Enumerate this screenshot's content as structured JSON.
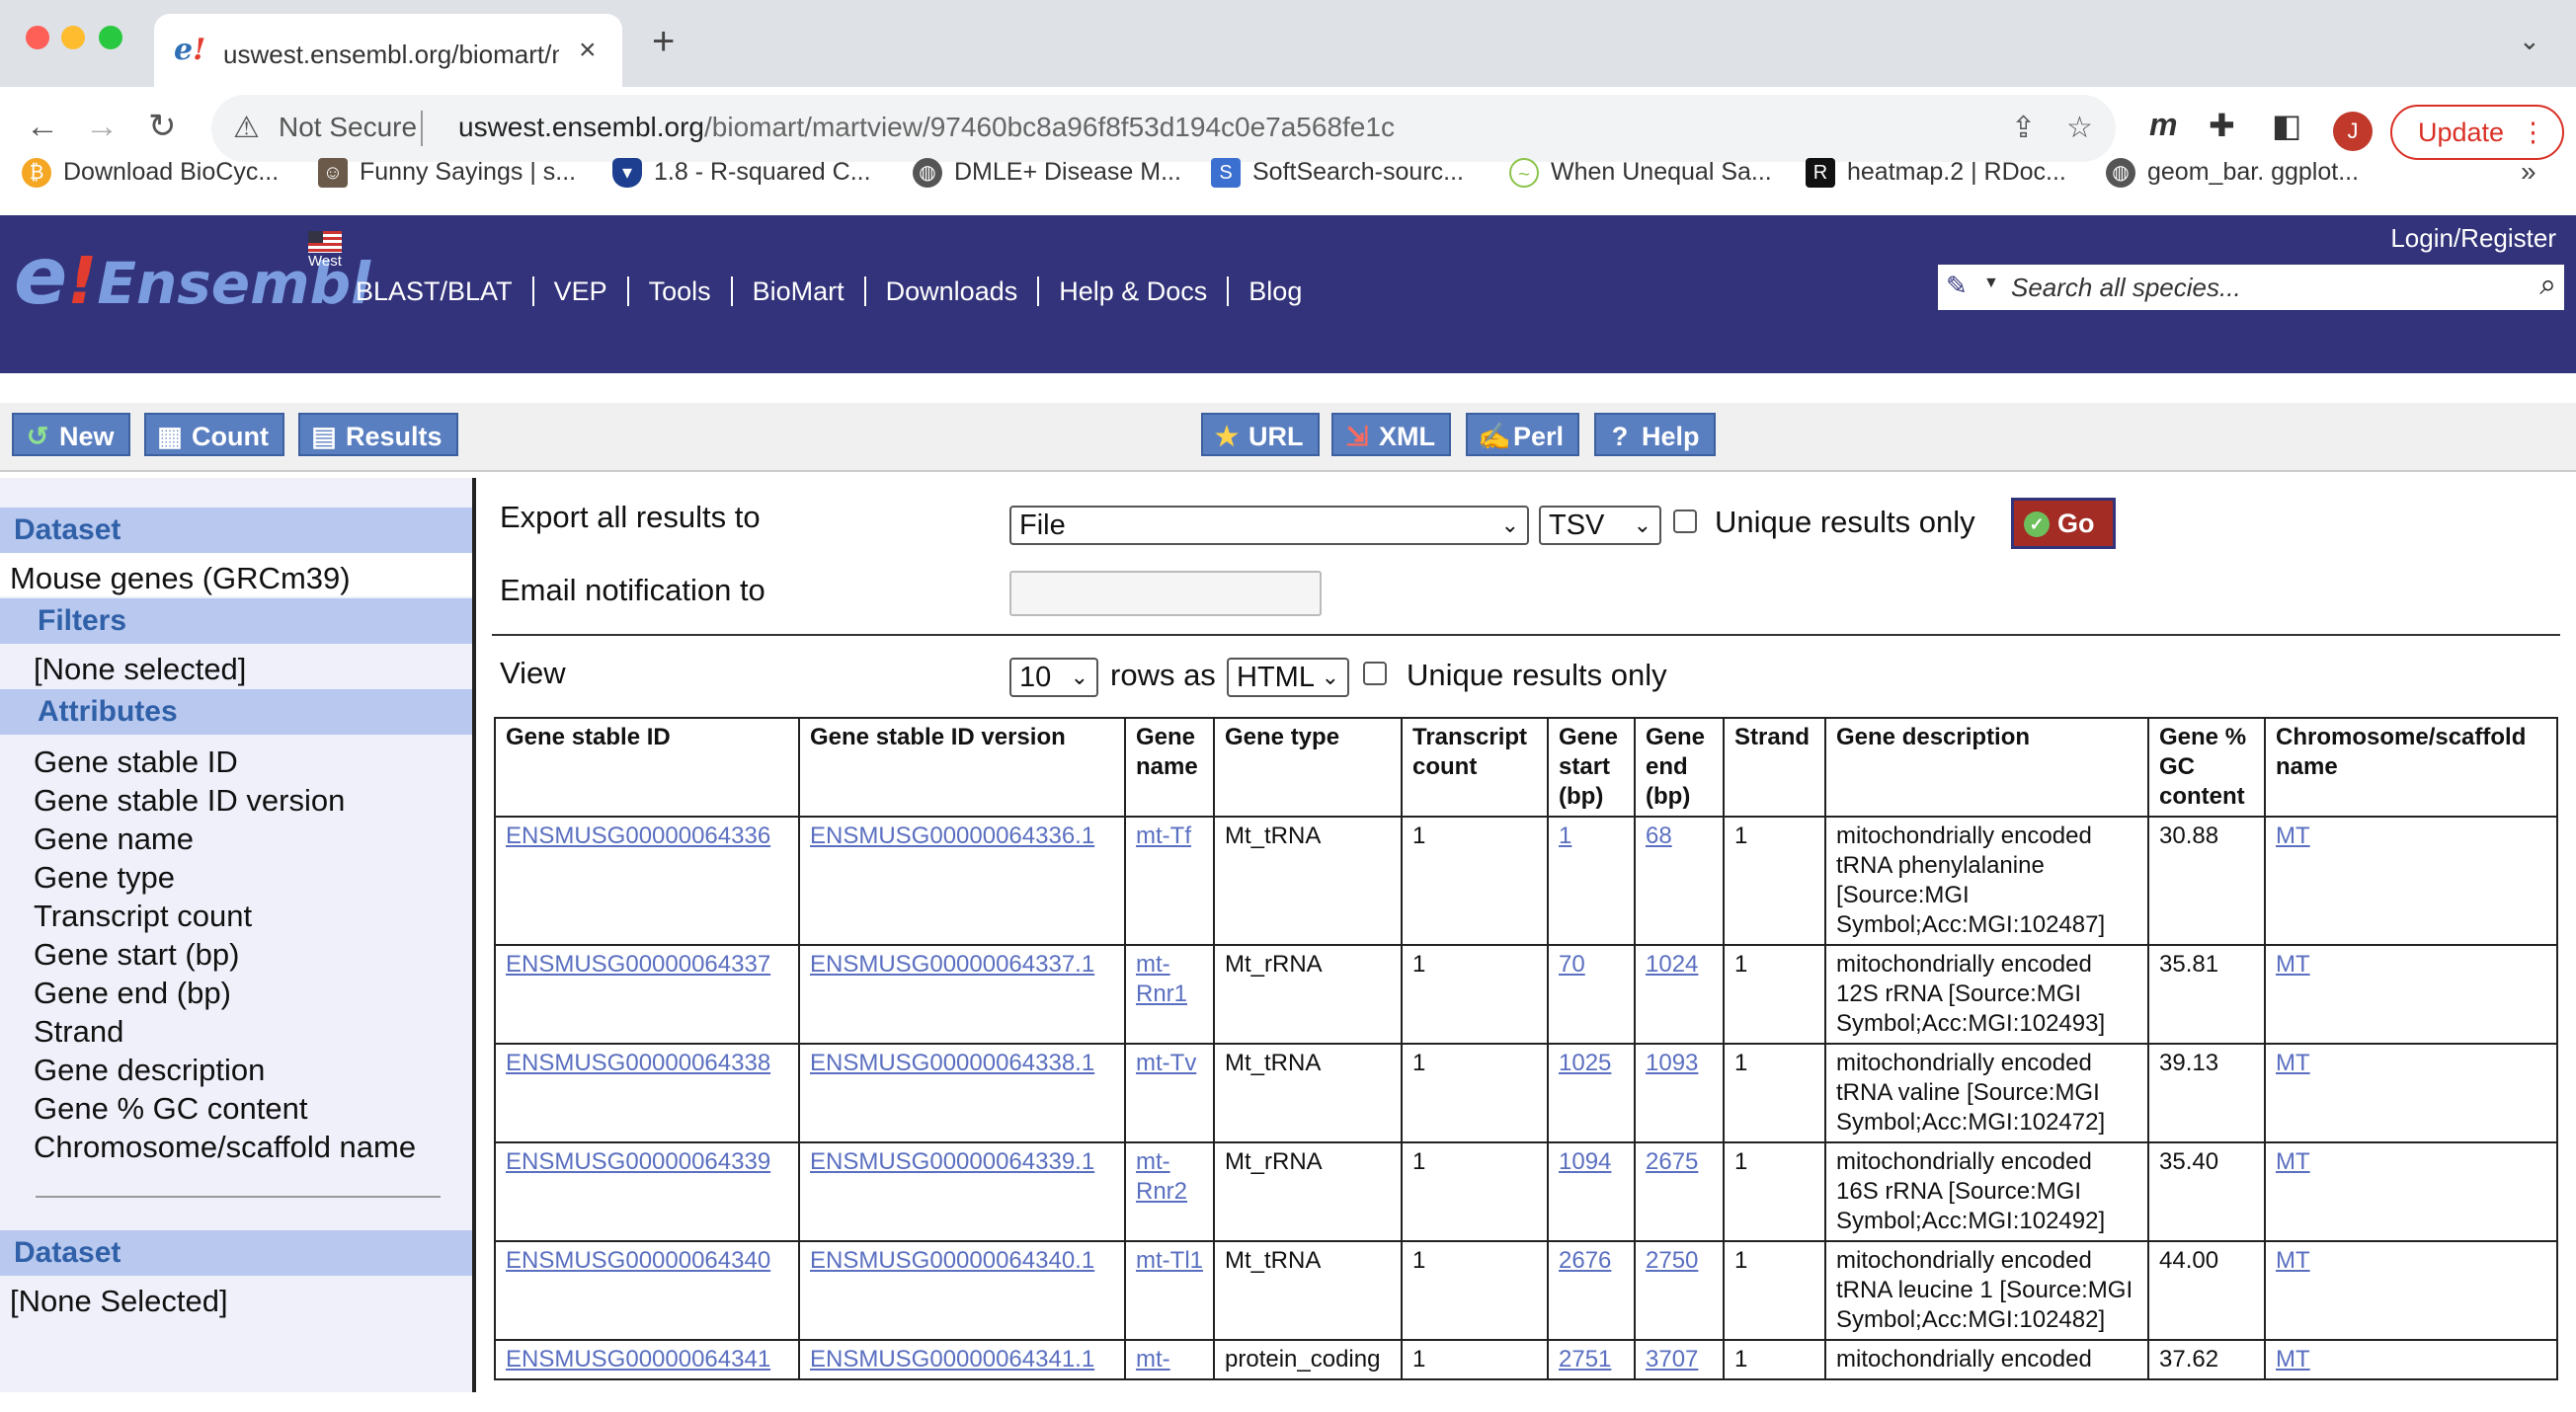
{
  "browser": {
    "tab_title": "uswest.ensembl.org/biomart/m",
    "tab_close": "×",
    "new_tab": "+",
    "tab_menu": "⌄",
    "not_secure": "Not Secure",
    "url_host": "uswest.ensembl.org",
    "url_path": "/biomart/martview/97460bc8a96f8f53d194c0e7a568fe1c",
    "profile_initial": "J",
    "update_label": "Update",
    "bookmarks": [
      {
        "label": "Download BioCyc...",
        "icon": "biocyc-icon",
        "color": "#f5a623"
      },
      {
        "label": "Funny Sayings | s...",
        "icon": "funny-sayings-icon",
        "color": "#6b5a4a"
      },
      {
        "label": "1.8 - R-squared C...",
        "icon": "penn-state-icon",
        "color": "#1e3f8f"
      },
      {
        "label": "DMLE+ Disease M...",
        "icon": "globe-icon",
        "color": "#555555"
      },
      {
        "label": "SoftSearch-sourc...",
        "icon": "softsearch-icon",
        "color": "#3b6fd0"
      },
      {
        "label": "When Unequal Sa...",
        "icon": "chart-line-icon",
        "color": "#8bc34a"
      },
      {
        "label": "heatmap.2 | RDoc...",
        "icon": "rdocumentation-icon",
        "color": "#111111"
      },
      {
        "label": "geom_bar. ggplot...",
        "icon": "globe-icon",
        "color": "#555555"
      }
    ],
    "bookmarks_more": "»"
  },
  "ensembl": {
    "logo_e": "e",
    "logo_bang": "!",
    "logo_name": "Ensembl",
    "logo_sub": "West",
    "login": "Login/Register",
    "nav": [
      "BLAST/BLAT",
      "VEP",
      "Tools",
      "BioMart",
      "Downloads",
      "Help & Docs",
      "Blog"
    ],
    "search_placeholder": "Search all species..."
  },
  "mart_toolbar": {
    "left": [
      {
        "label": "New",
        "icon": "refresh-icon"
      },
      {
        "label": "Count",
        "icon": "calculator-icon"
      },
      {
        "label": "Results",
        "icon": "table-icon"
      }
    ],
    "right": [
      {
        "label": "URL",
        "icon": "star-icon"
      },
      {
        "label": "XML",
        "icon": "xml-icon"
      },
      {
        "label": "Perl",
        "icon": "perl-icon"
      },
      {
        "label": "Help",
        "icon": "help-icon"
      }
    ]
  },
  "sidebar": {
    "dataset_heading": "Dataset",
    "dataset_value": "Mouse genes (GRCm39)",
    "filters_heading": "Filters",
    "filters_value": "[None selected]",
    "attributes_heading": "Attributes",
    "attributes": [
      "Gene stable ID",
      "Gene stable ID version",
      "Gene name",
      "Gene type",
      "Transcript count",
      "Gene start (bp)",
      "Gene end (bp)",
      "Strand",
      "Gene description",
      "Gene % GC content",
      "Chromosome/scaffold name"
    ],
    "dataset2_heading": "Dataset",
    "dataset2_value": "[None Selected]"
  },
  "export": {
    "export_label": "Export  all results to",
    "destination": "File",
    "format": "TSV",
    "unique_label": "Unique results only",
    "go_label": "Go",
    "email_label": "Email notification to",
    "view_label": "View",
    "rows": "10",
    "rows_as_label": "rows as",
    "view_format": "HTML",
    "view_unique_label": "Unique results only"
  },
  "table": {
    "headers": [
      "Gene stable ID",
      "Gene stable ID version",
      "Gene name",
      "Gene type",
      "Transcript count",
      "Gene start (bp)",
      "Gene end (bp)",
      "Strand",
      "Gene description",
      "Gene % GC content",
      "Chromosome/scaffold name"
    ],
    "rows": [
      [
        "ENSMUSG00000064336",
        "ENSMUSG00000064336.1",
        "mt-Tf",
        "Mt_tRNA",
        "1",
        "1",
        "68",
        "1",
        "mitochondrially encoded tRNA phenylalanine [Source:MGI Symbol;Acc:MGI:102487]",
        "30.88",
        "MT"
      ],
      [
        "ENSMUSG00000064337",
        "ENSMUSG00000064337.1",
        "mt-Rnr1",
        "Mt_rRNA",
        "1",
        "70",
        "1024",
        "1",
        "mitochondrially encoded 12S rRNA [Source:MGI Symbol;Acc:MGI:102493]",
        "35.81",
        "MT"
      ],
      [
        "ENSMUSG00000064338",
        "ENSMUSG00000064338.1",
        "mt-Tv",
        "Mt_tRNA",
        "1",
        "1025",
        "1093",
        "1",
        "mitochondrially encoded tRNA valine [Source:MGI Symbol;Acc:MGI:102472]",
        "39.13",
        "MT"
      ],
      [
        "ENSMUSG00000064339",
        "ENSMUSG00000064339.1",
        "mt-Rnr2",
        "Mt_rRNA",
        "1",
        "1094",
        "2675",
        "1",
        "mitochondrially encoded 16S rRNA [Source:MGI Symbol;Acc:MGI:102492]",
        "35.40",
        "MT"
      ],
      [
        "ENSMUSG00000064340",
        "ENSMUSG00000064340.1",
        "mt-Tl1",
        "Mt_tRNA",
        "1",
        "2676",
        "2750",
        "1",
        "mitochondrially encoded tRNA leucine 1 [Source:MGI Symbol;Acc:MGI:102482]",
        "44.00",
        "MT"
      ],
      [
        "ENSMUSG00000064341",
        "ENSMUSG00000064341.1",
        "mt-",
        "protein_coding",
        "1",
        "2751",
        "3707",
        "1",
        "mitochondrially encoded",
        "37.62",
        "MT"
      ]
    ],
    "link_columns": [
      0,
      1,
      2,
      5,
      6,
      10
    ]
  },
  "colors": {
    "ensembl_header": "#33337b",
    "mart_button": "#5a7fc0",
    "sidebar_heading_bg": "#b8c8ee",
    "sidebar_heading_text": "#3060a8",
    "link": "#5a6fc0",
    "go_button": "#a32c24"
  }
}
